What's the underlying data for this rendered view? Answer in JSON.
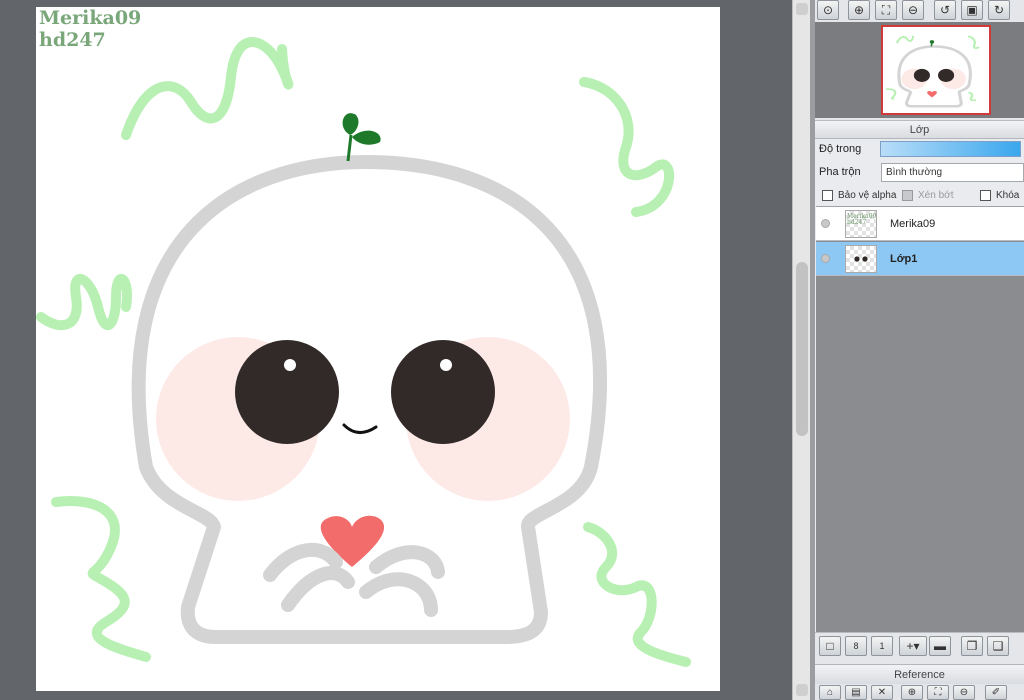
{
  "canvas": {
    "watermark_line1": "Merika09",
    "watermark_line2": "hd247"
  },
  "navigator_toolbar": {
    "icons": [
      "zoom-reset-icon",
      "zoom-in-icon",
      "fit-icon",
      "zoom-out-icon",
      "rotate-left-icon",
      "fullscreen-icon",
      "rotate-right-icon"
    ]
  },
  "layer_panel": {
    "title": "Lớp",
    "opacity_label": "Độ trong",
    "blend_label": "Pha trộn",
    "blend_value": "Bình thường",
    "protect_alpha_label": "Bảo vệ alpha",
    "clipping_label": "Xén bớt",
    "lock_label": "Khóa",
    "layers": [
      {
        "name": "Merika09",
        "selected": false
      },
      {
        "name": "Lớp1",
        "selected": true
      }
    ]
  },
  "reference_panel": {
    "title": "Reference"
  },
  "colors": {
    "accent_selected": "#8cc8f3",
    "navigator_frame": "#d23a3a",
    "squiggle_green": "#b8f0b4",
    "seedling_green": "#1e7a2a"
  }
}
